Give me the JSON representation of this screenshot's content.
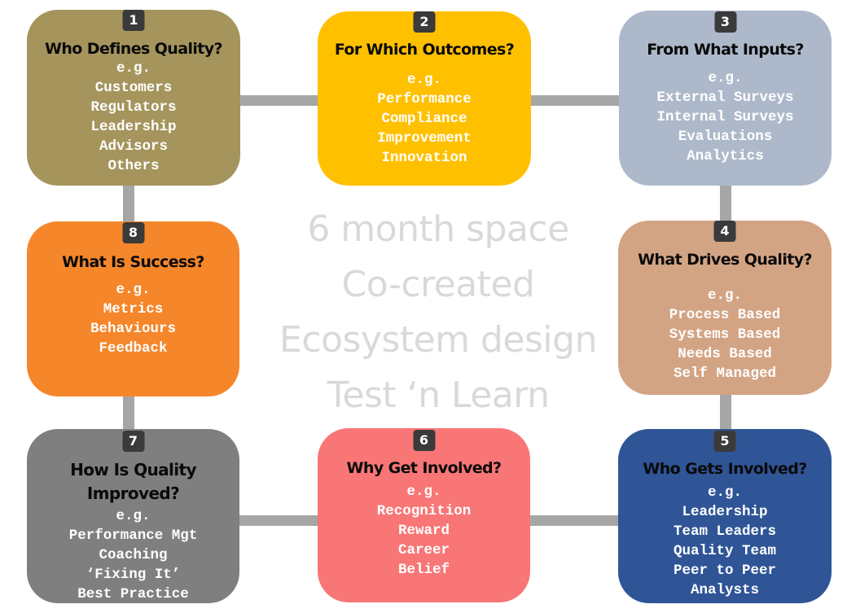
{
  "center": {
    "lines": [
      "6 month space",
      "Co-created",
      "Ecosystem design",
      "Test ‘n Learn"
    ]
  },
  "cards": [
    {
      "number": "1",
      "title": "Who Defines Quality?",
      "items": [
        "e.g.",
        "Customers",
        "Regulators",
        "Leadership",
        "Advisors",
        "Others"
      ],
      "color": "#a5955d"
    },
    {
      "number": "2",
      "title": "For Which Outcomes?",
      "items": [
        "e.g.",
        "Performance",
        "Compliance",
        "Improvement",
        "Innovation"
      ],
      "color": "#ffc000"
    },
    {
      "number": "3",
      "title": "From What Inputs?",
      "items": [
        "e.g.",
        "External Surveys",
        "Internal Surveys",
        "Evaluations",
        "Analytics"
      ],
      "color": "#adb9ca"
    },
    {
      "number": "4",
      "title": "What Drives Quality?",
      "items": [
        "e.g.",
        "Process Based",
        "Systems Based",
        "Needs Based",
        "Self Managed"
      ],
      "color": "#d3a484"
    },
    {
      "number": "5",
      "title": "Who Gets Involved?",
      "items": [
        "e.g.",
        "Leadership",
        "Team Leaders",
        "Quality Team",
        "Peer to Peer",
        "Analysts"
      ],
      "color": "#2f5597"
    },
    {
      "number": "6",
      "title": "Why Get Involved?",
      "items": [
        "e.g.",
        "Recognition",
        "Reward",
        "Career",
        "Belief"
      ],
      "color": "#f87676"
    },
    {
      "number": "7",
      "title": "How Is Quality Improved?",
      "title_lines": [
        "How Is Quality",
        "Improved?"
      ],
      "items": [
        "e.g.",
        "Performance Mgt",
        "Coaching",
        "‘Fixing It’",
        "Best Practice"
      ],
      "color": "#7f7f7f"
    },
    {
      "number": "8",
      "title": "What Is Success?",
      "items": [
        "e.g.",
        "Metrics",
        "Behaviours",
        "Feedback"
      ],
      "color": "#f5862a"
    }
  ],
  "connector_color": "#a6a6a6",
  "badge_color": "#3a3a3a"
}
